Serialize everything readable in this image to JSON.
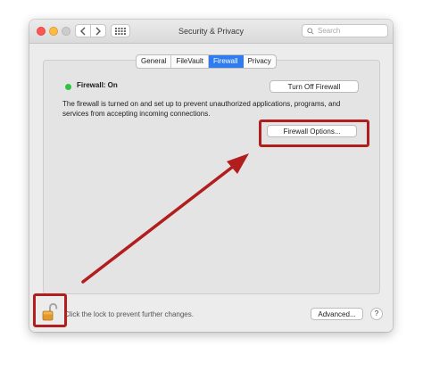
{
  "window": {
    "title": "Security & Privacy"
  },
  "search": {
    "placeholder": "Search"
  },
  "tabs": [
    {
      "label": "General",
      "active": false
    },
    {
      "label": "FileVault",
      "active": false
    },
    {
      "label": "Firewall",
      "active": true
    },
    {
      "label": "Privacy",
      "active": false
    }
  ],
  "firewall": {
    "status": "Firewall: On",
    "status_color": "#2ec441",
    "turn_off_label": "Turn Off Firewall",
    "description": "The firewall is turned on and set up to prevent unauthorized applications, programs, and services from accepting incoming connections.",
    "options_label": "Firewall Options..."
  },
  "footer": {
    "lock_text": "Click the lock to prevent further changes.",
    "advanced_label": "Advanced...",
    "help_label": "?"
  },
  "annotation": {
    "color": "#b21d1d"
  },
  "icons": [
    "close-icon",
    "minimize-icon",
    "zoom-icon",
    "chevron-left-icon",
    "chevron-right-icon",
    "grid-icon",
    "search-icon",
    "lock-icon",
    "arrow-annotation"
  ]
}
